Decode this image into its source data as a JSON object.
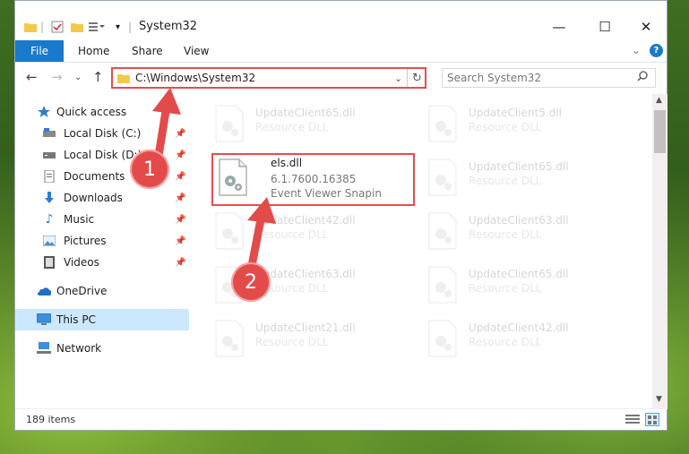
{
  "window": {
    "title": "System32",
    "controls": {
      "minimize": "—",
      "maximize": "☐",
      "close": "✕"
    }
  },
  "ribbon": {
    "tabs": [
      "File",
      "Home",
      "Share",
      "View"
    ],
    "help": "?"
  },
  "address": {
    "path": "C:\\Windows\\System32",
    "search_placeholder": "Search System32"
  },
  "nav": {
    "items": [
      {
        "label": "Quick access",
        "icon": "star-icon",
        "pinned": false
      },
      {
        "label": "Local Disk (C:)",
        "icon": "drive-icon",
        "pinned": true
      },
      {
        "label": "Local Disk (D:)",
        "icon": "drive-icon",
        "pinned": true
      },
      {
        "label": "Documents",
        "icon": "documents-icon",
        "pinned": true
      },
      {
        "label": "Downloads",
        "icon": "download-icon",
        "pinned": true
      },
      {
        "label": "Music",
        "icon": "music-icon",
        "pinned": true
      },
      {
        "label": "Pictures",
        "icon": "pictures-icon",
        "pinned": true
      },
      {
        "label": "Videos",
        "icon": "videos-icon",
        "pinned": true
      },
      {
        "label": "OneDrive",
        "icon": "onedrive-icon",
        "pinned": false
      },
      {
        "label": "This PC",
        "icon": "pc-icon",
        "pinned": false
      },
      {
        "label": "Network",
        "icon": "network-icon",
        "pinned": false
      }
    ]
  },
  "files": [
    {
      "name": "UpdateClient65.dll",
      "sub": "Resource DLL",
      "faded": true
    },
    {
      "name": "UpdateClient5.dll",
      "sub": "Resource DLL",
      "faded": true
    },
    {
      "name": "els.dll",
      "version": "6.1.7600.16385",
      "sub": "Event Viewer Snapin",
      "faded": false
    },
    {
      "name": "UpdateClient65.dll",
      "sub": "Resource DLL",
      "faded": true
    },
    {
      "name": "UpdateClient42.dll",
      "sub": "Resource DLL",
      "faded": true
    },
    {
      "name": "UpdateClient63.dll",
      "sub": "Resource DLL",
      "faded": true
    },
    {
      "name": "UpdateClient63.dll",
      "sub": "Resource DLL",
      "faded": true
    },
    {
      "name": "UpdateClient65.dll",
      "sub": "Resource DLL",
      "faded": true
    },
    {
      "name": "UpdateClient21.dll",
      "sub": "Resource DLL",
      "faded": true
    },
    {
      "name": "UpdateClient42.dll",
      "sub": "Resource DLL",
      "faded": true
    }
  ],
  "status": {
    "count": "189 items"
  },
  "annotations": {
    "step1": "1",
    "step2": "2"
  },
  "colors": {
    "accent": "#1979ca",
    "highlight": "#e84c4c",
    "selected": "#cce8ff"
  }
}
